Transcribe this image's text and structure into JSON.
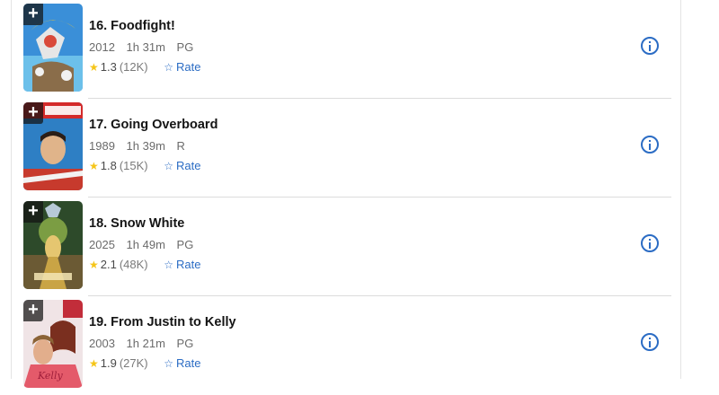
{
  "movies": [
    {
      "title": "16. Foodfight!",
      "year": "2012",
      "runtime": "1h 31m",
      "certificate": "PG",
      "rating": "1.3",
      "votes": "(12K)",
      "rate_label": "Rate"
    },
    {
      "title": "17. Going Overboard",
      "year": "1989",
      "runtime": "1h 39m",
      "certificate": "R",
      "rating": "1.8",
      "votes": "(15K)",
      "rate_label": "Rate"
    },
    {
      "title": "18. Snow White",
      "year": "2025",
      "runtime": "1h 49m",
      "certificate": "PG",
      "rating": "2.1",
      "votes": "(48K)",
      "rate_label": "Rate"
    },
    {
      "title": "19. From Justin to Kelly",
      "year": "2003",
      "runtime": "1h 21m",
      "certificate": "PG",
      "rating": "1.9",
      "votes": "(27K)",
      "rate_label": "Rate"
    }
  ],
  "colors": {
    "accent": "#2b6cc4",
    "star": "#f5c518",
    "divider": "#dcdcdc"
  },
  "icons": {
    "add": "plus-icon",
    "star": "star-icon",
    "rate": "star-outline-icon",
    "info": "info-icon"
  }
}
